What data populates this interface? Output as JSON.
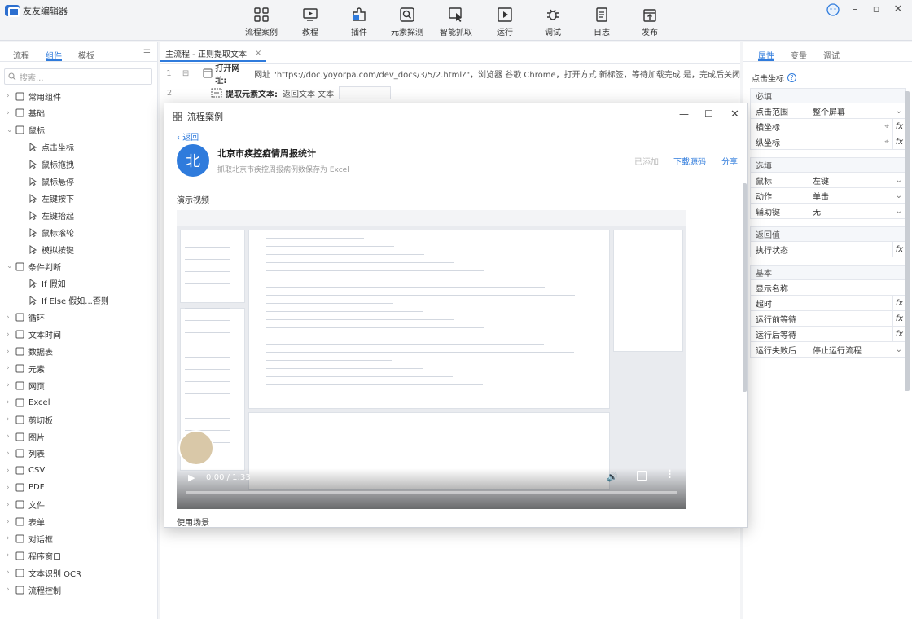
{
  "app": {
    "title": "友友编辑器",
    "brand_color": "#2f7bdc"
  },
  "toolbar": [
    {
      "label": "流程案例",
      "icon": "grid-icon"
    },
    {
      "label": "教程",
      "icon": "play-screen-icon"
    },
    {
      "label": "插件",
      "icon": "puzzle-icon"
    },
    {
      "label": "元素探测",
      "icon": "magnifier-icon"
    },
    {
      "label": "智能抓取",
      "icon": "cursor-grab-icon"
    },
    {
      "label": "运行",
      "icon": "run-icon"
    },
    {
      "label": "调试",
      "icon": "bug-icon"
    },
    {
      "label": "日志",
      "icon": "doc-icon"
    },
    {
      "label": "发布",
      "icon": "publish-icon"
    }
  ],
  "left_panel": {
    "tabs": [
      "流程",
      "组件",
      "模板"
    ],
    "active_tab": "组件",
    "search_placeholder": "搜索...",
    "tree": [
      {
        "label": "常用组件",
        "level": 0
      },
      {
        "label": "基础",
        "level": 0
      },
      {
        "label": "鼠标",
        "level": 0,
        "expanded": true
      },
      {
        "label": "点击坐标",
        "level": 1
      },
      {
        "label": "鼠标拖拽",
        "level": 1
      },
      {
        "label": "鼠标悬停",
        "level": 1
      },
      {
        "label": "左键按下",
        "level": 1
      },
      {
        "label": "左键抬起",
        "level": 1
      },
      {
        "label": "鼠标滚轮",
        "level": 1
      },
      {
        "label": "模拟按键",
        "level": 1
      },
      {
        "label": "条件判断",
        "level": 0,
        "expanded": true
      },
      {
        "label": "If 假如",
        "level": 1
      },
      {
        "label": "If Else 假如...否则",
        "level": 1
      },
      {
        "label": "循环",
        "level": 0
      },
      {
        "label": "文本时间",
        "level": 0
      },
      {
        "label": "数据表",
        "level": 0
      },
      {
        "label": "元素",
        "level": 0
      },
      {
        "label": "网页",
        "level": 0
      },
      {
        "label": "Excel",
        "level": 0
      },
      {
        "label": "剪切板",
        "level": 0
      },
      {
        "label": "图片",
        "level": 0
      },
      {
        "label": "列表",
        "level": 0
      },
      {
        "label": "CSV",
        "level": 0
      },
      {
        "label": "PDF",
        "level": 0
      },
      {
        "label": "文件",
        "level": 0
      },
      {
        "label": "表单",
        "level": 0
      },
      {
        "label": "对话框",
        "level": 0
      },
      {
        "label": "程序窗口",
        "level": 0
      },
      {
        "label": "文本识别 OCR",
        "level": 0
      },
      {
        "label": "流程控制",
        "level": 0
      }
    ]
  },
  "editor": {
    "tab_label": "主流程 - 正则提取文本",
    "lines": [
      {
        "no": "1",
        "bold": "打开网址:",
        "text": "网址 \"https://doc.yoyorpa.com/dev_docs/3/5/2.html?\"，浏览器 谷歌 Chrome，打开方式 新标签，等待加载完成 是，完成后关闭网页 否"
      },
      {
        "no": "2",
        "bold": "提取元素文本:",
        "text": "返回文本 文本"
      }
    ]
  },
  "modal": {
    "title": "流程案例",
    "back": "返回",
    "case_icon_char": "北",
    "case_title": "北京市疾控疫情周报统计",
    "case_desc": "抓取北京市疾控周报病例数保存为 Excel",
    "btn_added": "已添加",
    "btn_download": "下载源码",
    "btn_share": "分享",
    "section_video": "演示视频",
    "section_usage": "使用场景",
    "video_time": "0:00 / 1:33"
  },
  "right_panel": {
    "tabs": [
      "属性",
      "变量",
      "调试"
    ],
    "active_tab": "属性",
    "component_title": "点击坐标",
    "sections": [
      {
        "title": "必填",
        "rows": [
          {
            "key": "点击范围",
            "value": "整个屏幕",
            "type": "select"
          },
          {
            "key": "横坐标",
            "value": "",
            "type": "target"
          },
          {
            "key": "纵坐标",
            "value": "",
            "type": "target"
          }
        ]
      },
      {
        "title": "选填",
        "rows": [
          {
            "key": "鼠标",
            "value": "左键",
            "type": "select"
          },
          {
            "key": "动作",
            "value": "单击",
            "type": "select"
          },
          {
            "key": "辅助键",
            "value": "无",
            "type": "select"
          }
        ]
      },
      {
        "title": "返回值",
        "rows": [
          {
            "key": "执行状态",
            "value": "",
            "type": "fx"
          }
        ]
      },
      {
        "title": "基本",
        "rows": [
          {
            "key": "显示名称",
            "value": "",
            "type": "plain"
          },
          {
            "key": "超时",
            "value": "",
            "type": "fx"
          },
          {
            "key": "运行前等待",
            "value": "",
            "type": "fx"
          },
          {
            "key": "运行后等待",
            "value": "",
            "type": "fx"
          },
          {
            "key": "运行失败后",
            "value": "停止运行流程",
            "type": "select"
          }
        ]
      }
    ]
  }
}
